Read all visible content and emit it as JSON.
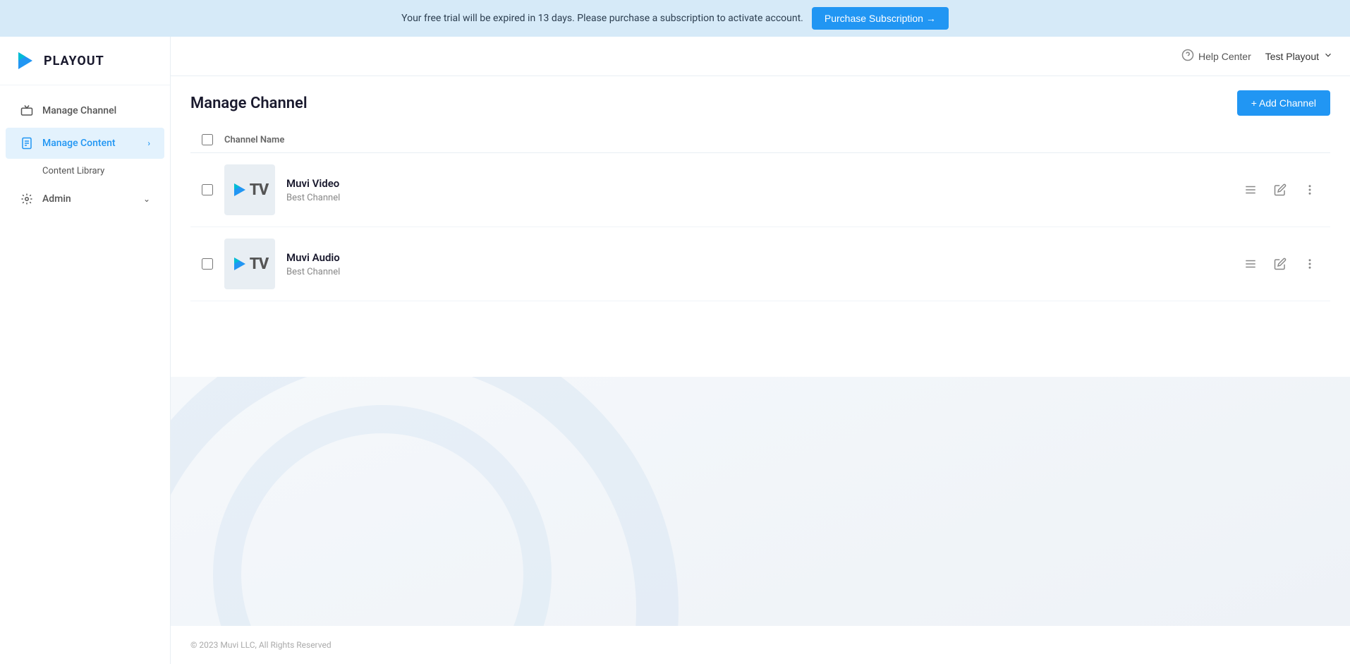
{
  "banner": {
    "text": "Your free trial will be expired in 13 days. Please purchase a subscription to activate account.",
    "button_label": "Purchase Subscription →"
  },
  "logo": {
    "text": "PLAYOUT"
  },
  "sidebar": {
    "items": [
      {
        "id": "manage-channel",
        "label": "Manage Channel",
        "icon": "tv-icon",
        "active": false
      },
      {
        "id": "manage-content",
        "label": "Manage Content",
        "icon": "document-icon",
        "active": true,
        "has_chevron": true
      },
      {
        "id": "content-library",
        "label": "Content Library",
        "is_sub": true
      },
      {
        "id": "admin",
        "label": "Admin",
        "icon": "gear-icon",
        "active": false,
        "has_chevron": true
      }
    ]
  },
  "header": {
    "help_label": "Help Center",
    "user_label": "Test Playout"
  },
  "page": {
    "title": "Manage Channel",
    "add_button_label": "+ Add Channel",
    "table_header": "Channel Name",
    "footer_text": "© 2023 Muvi LLC, All Rights Reserved"
  },
  "channels": [
    {
      "id": "channel-1",
      "name": "Muvi Video",
      "subtitle": "Best Channel"
    },
    {
      "id": "channel-2",
      "name": "Muvi Audio",
      "subtitle": "Best Channel"
    }
  ]
}
